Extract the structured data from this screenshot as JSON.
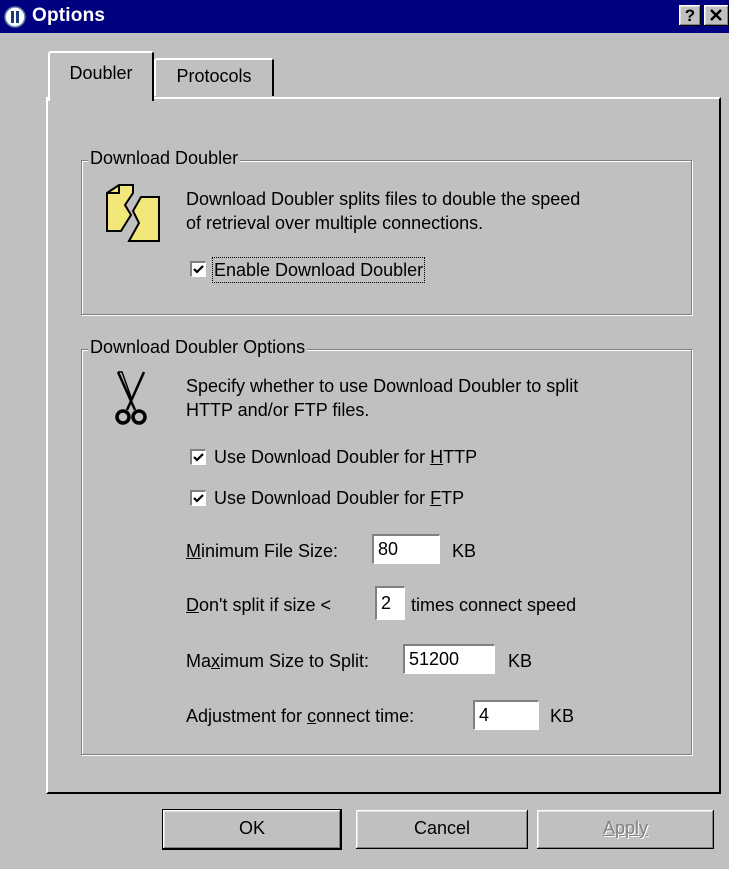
{
  "window": {
    "title": "Options",
    "help_label": "?",
    "close_label": "✕"
  },
  "tabs": [
    {
      "label": "Doubler",
      "selected": true
    },
    {
      "label": "Protocols",
      "selected": false
    }
  ],
  "group_download": {
    "legend": "Download Doubler",
    "description_line1": "Download Doubler splits files to double the speed",
    "description_line2": "of retrieval over multiple connections.",
    "enable_checkbox": {
      "label": "Enable Download Doubler",
      "checked": true
    }
  },
  "group_options": {
    "legend": "Download Doubler Options",
    "description_line1": "Specify whether to use Download Doubler to split",
    "description_line2": "HTTP and/or FTP files.",
    "http_checkbox": {
      "label_prefix": "Use Download Doubler for ",
      "label_accel": "H",
      "label_rest": "TTP",
      "checked": true
    },
    "ftp_checkbox": {
      "label_prefix": "Use Download Doubler for ",
      "label_accel": "F",
      "label_rest": "TP",
      "checked": true
    },
    "min_file_size": {
      "label_accel": "M",
      "label_rest": "inimum File Size:",
      "value": "80",
      "unit": "KB"
    },
    "dont_split": {
      "label_accel": "D",
      "label_rest": "on't split if size <",
      "value": "2",
      "suffix": "times connect speed"
    },
    "max_size": {
      "label_pre": "Ma",
      "label_accel": "x",
      "label_rest": "imum Size to Split:",
      "value": "51200",
      "unit": "KB"
    },
    "adjustment": {
      "label_pre": "Adjustment for ",
      "label_accel": "c",
      "label_rest": "onnect time:",
      "value": "4",
      "unit": "KB"
    }
  },
  "buttons": {
    "ok": "OK",
    "cancel": "Cancel",
    "apply": "Apply"
  },
  "colors": {
    "titlebar": "#000080",
    "face": "#c0c0c0",
    "folder_icon": "#f2e87a"
  }
}
